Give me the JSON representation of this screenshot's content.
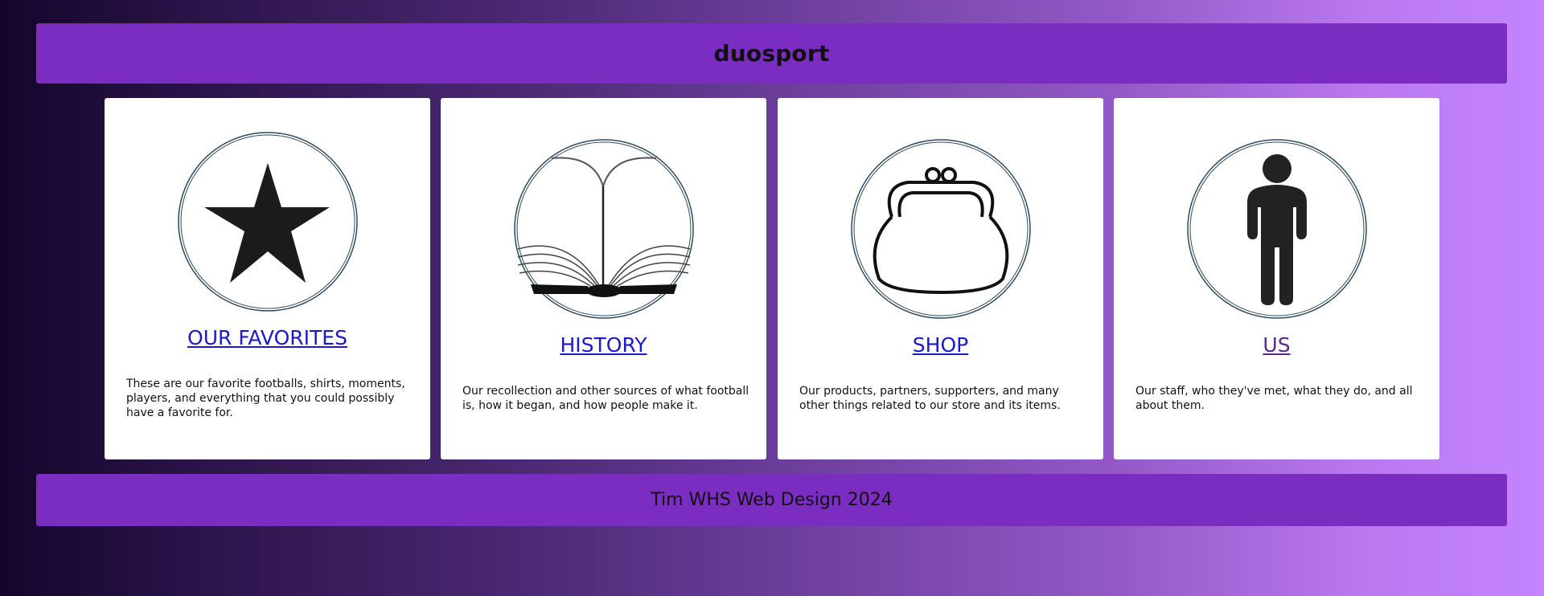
{
  "header": {
    "title": "duosport"
  },
  "cards": [
    {
      "icon": "star-icon",
      "link": "OUR FAVORITES",
      "description": "These are our favorite footballs, shirts, moments, players, and everything that you could possibly have a favorite for."
    },
    {
      "icon": "book-icon",
      "link": "HISTORY",
      "description": "Our recollection and other sources of what football is, how it began, and how people make it."
    },
    {
      "icon": "purse-icon",
      "link": "SHOP",
      "description": "Our products, partners, supporters, and many other things related to our store and its items."
    },
    {
      "icon": "person-icon",
      "link": "US",
      "description": "Our staff, who they've met, what they do, and all about them."
    }
  ],
  "footer": {
    "text": "Tim WHS Web Design 2024"
  },
  "colors": {
    "bar": "#7b2cc1",
    "link": "#1a1acc",
    "visited_link": "#5b2a86",
    "card": "#ffffff"
  }
}
